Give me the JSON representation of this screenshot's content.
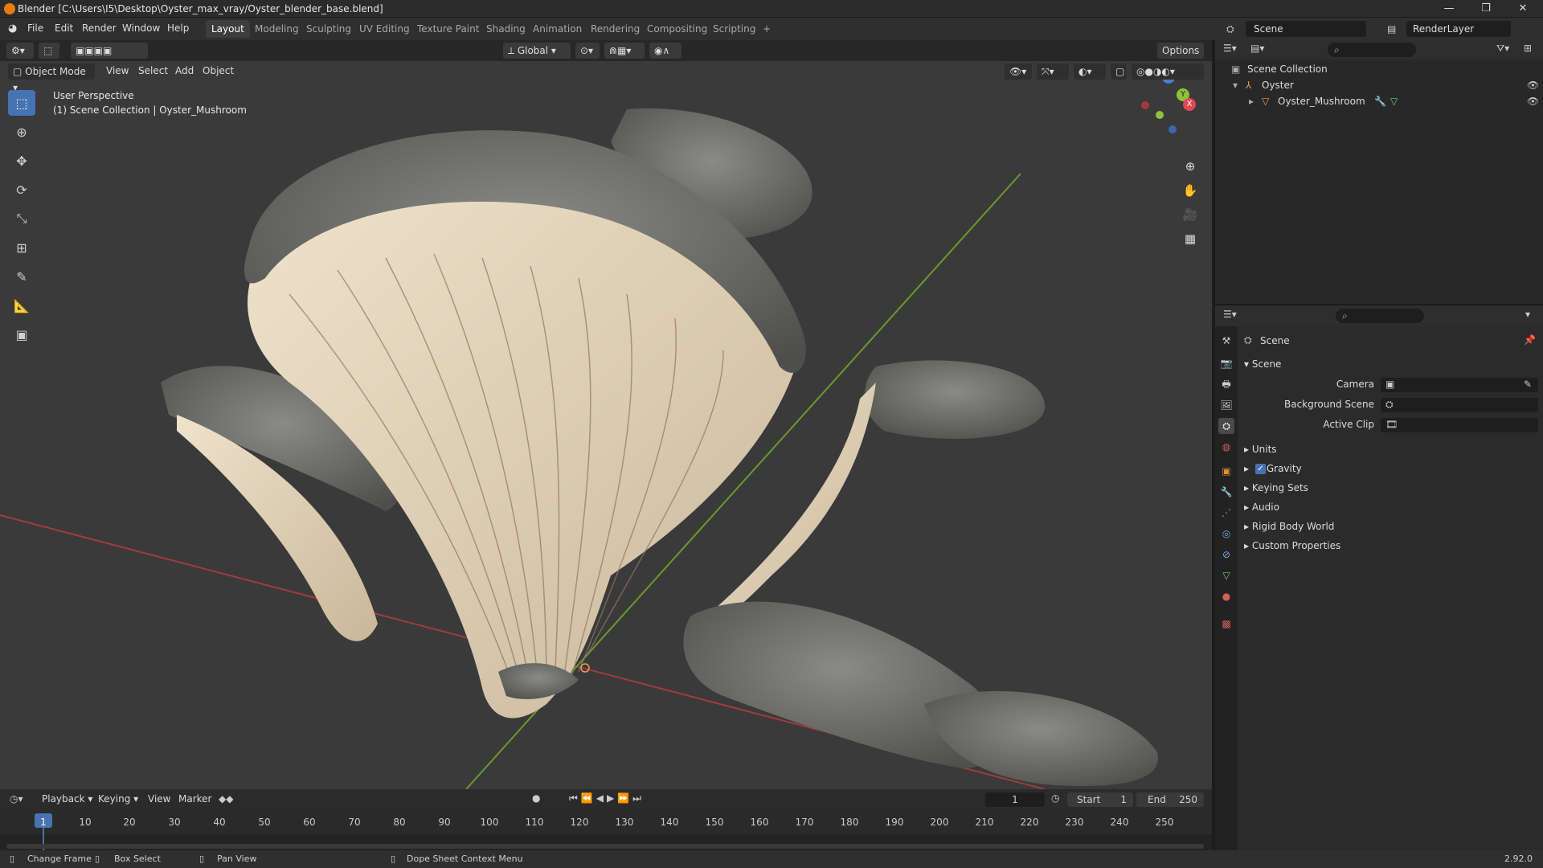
{
  "window": {
    "title": "Blender [C:\\Users\\I5\\Desktop\\Oyster_max_vray/Oyster_blender_base.blend]",
    "controls": [
      "—",
      "❐",
      "✕"
    ]
  },
  "menu": [
    "File",
    "Edit",
    "Render",
    "Window",
    "Help"
  ],
  "workspaces": [
    "Layout",
    "Modeling",
    "Sculpting",
    "UV Editing",
    "Texture Paint",
    "Shading",
    "Animation",
    "Rendering",
    "Compositing",
    "Scripting",
    "+"
  ],
  "active_workspace": "Layout",
  "top_right": {
    "scene": "Scene",
    "view_layer": "RenderLayer"
  },
  "viewport_header": {
    "mode": "Object Mode",
    "menus": [
      "View",
      "Select",
      "Add",
      "Object"
    ],
    "transform_orientation": "Global",
    "options": "Options"
  },
  "viewport": {
    "perspective": "User Perspective",
    "collection_info": "(1) Scene Collection | Oyster_Mushroom",
    "gizmo_axes": [
      "Z",
      "Y",
      "X"
    ]
  },
  "tools": [
    "select-box",
    "cursor",
    "move",
    "rotate",
    "scale",
    "transform",
    "annotate",
    "measure",
    "add-cube"
  ],
  "outliner": {
    "root": "Scene Collection",
    "items": [
      {
        "label": "Oyster",
        "type": "empty"
      },
      {
        "label": "Oyster_Mushroom",
        "type": "mesh"
      }
    ]
  },
  "properties": {
    "context": "Scene",
    "section": "Scene",
    "fields": [
      {
        "label": "Camera",
        "value": ""
      },
      {
        "label": "Background Scene",
        "value": ""
      },
      {
        "label": "Active Clip",
        "value": ""
      }
    ],
    "panels": [
      {
        "label": "Units",
        "checkbox": false
      },
      {
        "label": "Gravity",
        "checkbox": true
      },
      {
        "label": "Keying Sets",
        "checkbox": false
      },
      {
        "label": "Audio",
        "checkbox": false
      },
      {
        "label": "Rigid Body World",
        "checkbox": false
      },
      {
        "label": "Custom Properties",
        "checkbox": false
      }
    ]
  },
  "timeline": {
    "menus": [
      "Playback",
      "Keying",
      "View",
      "Marker"
    ],
    "current_frame": "1",
    "start_label": "Start",
    "start": "1",
    "end_label": "End",
    "end": "250",
    "ticks": [
      "1",
      "10",
      "20",
      "30",
      "40",
      "50",
      "60",
      "70",
      "80",
      "90",
      "100",
      "110",
      "120",
      "130",
      "140",
      "150",
      "160",
      "170",
      "180",
      "190",
      "200",
      "210",
      "220",
      "230",
      "240",
      "250"
    ]
  },
  "statusbar": {
    "items": [
      "Change Frame",
      "Box Select",
      "Pan View",
      "Dope Sheet Context Menu"
    ],
    "version": "2.92.0"
  }
}
